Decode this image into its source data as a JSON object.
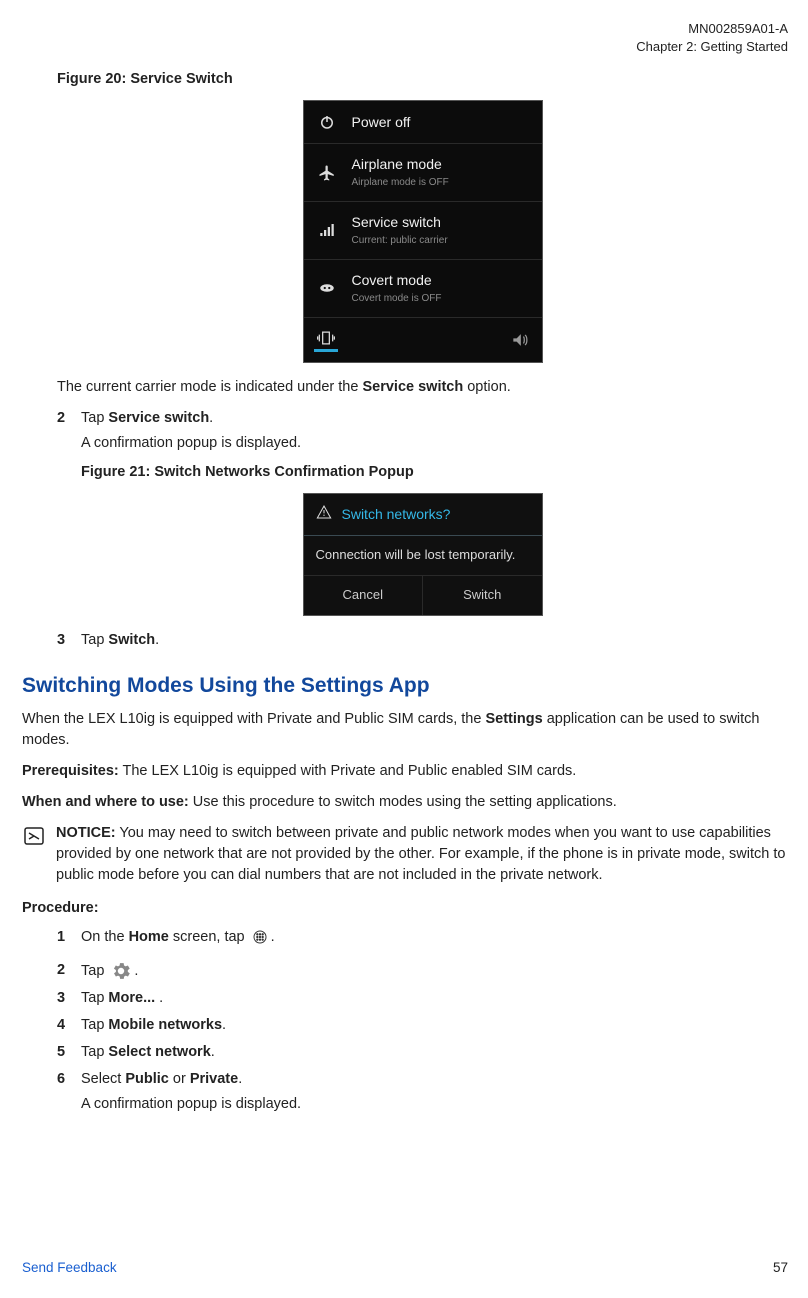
{
  "pageHeader": {
    "docId": "MN002859A01-A",
    "chapter": "Chapter 2:  Getting Started"
  },
  "figure20": {
    "caption": "Figure 20: Service Switch",
    "rows": [
      {
        "icon": "power-icon",
        "title": "Power off",
        "sub": ""
      },
      {
        "icon": "airplane-icon",
        "title": "Airplane mode",
        "sub": "Airplane mode is OFF"
      },
      {
        "icon": "signal-icon",
        "title": "Service switch",
        "sub": "Current: public carrier"
      },
      {
        "icon": "mask-icon",
        "title": "Covert mode",
        "sub": "Covert mode is OFF"
      }
    ],
    "noteAfter": "The current carrier mode is indicated under the ",
    "noteBold": "Service switch",
    "noteAfter2": " option."
  },
  "step2Top": {
    "num": "2",
    "tap": "Tap ",
    "bold": "Service switch",
    "after": ".",
    "sub": "A confirmation popup is displayed."
  },
  "figure21": {
    "caption": "Figure 21: Switch Networks Confirmation Popup",
    "title": "Switch networks?",
    "body": "Connection will be lost temporarily.",
    "cancel": "Cancel",
    "switch": "Switch"
  },
  "step3Top": {
    "num": "3",
    "tap": "Tap ",
    "bold": "Switch",
    "after": "."
  },
  "section": {
    "title": "Switching Modes Using the Settings App",
    "intro1": "When the LEX L10ig is equipped with Private and Public SIM cards, the ",
    "introBold1": "Settings",
    "intro2": " application can be used to switch modes.",
    "prereqLabel": "Prerequisites:",
    "prereqText": " The LEX L10ig is equipped with Private and Public enabled SIM cards.",
    "whenLabel": "When and where to use:",
    "whenText": " Use this procedure to switch modes using the setting applications.",
    "noticeLabel": "NOTICE:",
    "noticeText": " You may need to switch between private and public network modes when you want to use capabilities provided by one network that are not provided by the other. For example, if the phone is in private mode, switch to public mode before you can dial numbers that are not included in the private network.",
    "procLabel": "Procedure:",
    "steps": {
      "s1": {
        "num": "1",
        "pre": "On the ",
        "bold": "Home",
        "mid": " screen, tap ",
        "after": "."
      },
      "s2": {
        "num": "2",
        "pre": "Tap ",
        "after": "."
      },
      "s3": {
        "num": "3",
        "pre": "Tap ",
        "bold": "More...",
        "after": " ."
      },
      "s4": {
        "num": "4",
        "pre": "Tap ",
        "bold": "Mobile networks",
        "after": "."
      },
      "s5": {
        "num": "5",
        "pre": "Tap ",
        "bold": "Select network",
        "after": "."
      },
      "s6": {
        "num": "6",
        "pre": "Select ",
        "bold1": "Public",
        "or": " or ",
        "bold2": "Private",
        "after": ".",
        "sub": "A confirmation popup is displayed."
      }
    }
  },
  "footer": {
    "link": "Send Feedback",
    "page": "57"
  }
}
